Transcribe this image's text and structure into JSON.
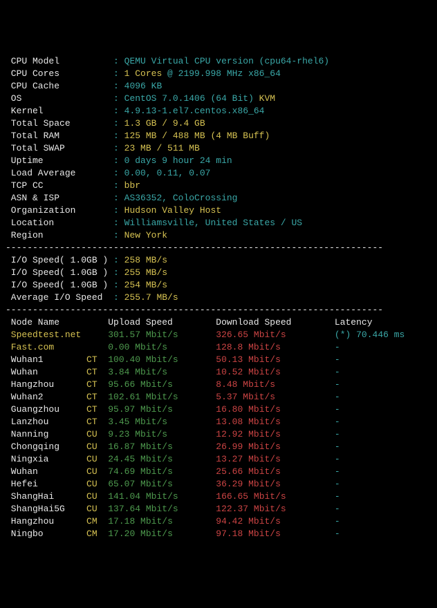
{
  "sysinfo": [
    {
      "label": "CPU Model",
      "value": "QEMU Virtual CPU version (cpu64-rhel6)",
      "color": "cyan"
    },
    {
      "label": "CPU Cores",
      "value": "1 Cores",
      "color": "yellow",
      "suffix": " @ 2199.998 MHz x86_64",
      "suffix_color": "cyan"
    },
    {
      "label": "CPU Cache",
      "value": "4096 KB",
      "color": "cyan"
    },
    {
      "label": "OS",
      "value": "CentOS 7.0.1406 (64 Bit)",
      "color": "cyan",
      "suffix": " KVM",
      "suffix_color": "yellow"
    },
    {
      "label": "Kernel",
      "value": "4.9.13-1.el7.centos.x86_64",
      "color": "cyan"
    },
    {
      "label": "Total Space",
      "value": "1.3 GB / 9.4 GB",
      "color": "yellow"
    },
    {
      "label": "Total RAM",
      "value": "125 MB / 488 MB (4 MB Buff)",
      "color": "yellow"
    },
    {
      "label": "Total SWAP",
      "value": "23 MB / 511 MB",
      "color": "yellow"
    },
    {
      "label": "Uptime",
      "value": "0 days 9 hour 24 min",
      "color": "cyan"
    },
    {
      "label": "Load Average",
      "value": "0.00, 0.11, 0.07",
      "color": "cyan"
    },
    {
      "label": "TCP CC",
      "value": "bbr",
      "color": "yellow"
    },
    {
      "label": "ASN & ISP",
      "value": "AS36352, ColoCrossing",
      "color": "cyan"
    },
    {
      "label": "Organization",
      "value": "Hudson Valley Host",
      "color": "yellow"
    },
    {
      "label": "Location",
      "value": "Williamsville, United States / US",
      "color": "cyan"
    },
    {
      "label": "Region",
      "value": "New York",
      "color": "yellow"
    }
  ],
  "io": [
    {
      "label": "I/O Speed( 1.0GB )",
      "value": "258 MB/s"
    },
    {
      "label": "I/O Speed( 1.0GB )",
      "value": "255 MB/s"
    },
    {
      "label": "I/O Speed( 1.0GB )",
      "value": "254 MB/s"
    },
    {
      "label": "Average I/O Speed",
      "value": "255.7 MB/s"
    }
  ],
  "speed_header": {
    "node": "Node Name",
    "upload": "Upload Speed",
    "download": "Download Speed",
    "latency": "Latency"
  },
  "speed": [
    {
      "node": "Speedtest.net",
      "isp": "",
      "upload": "301.57 Mbit/s",
      "download": "326.65 Mbit/s",
      "latency": "(*) 70.446 ms",
      "node_color": "yellow"
    },
    {
      "node": "Fast.com",
      "isp": "",
      "upload": "0.00 Mbit/s",
      "download": "128.8 Mbit/s",
      "latency": "-",
      "node_color": "yellow"
    },
    {
      "node": "Wuhan1",
      "isp": "CT",
      "upload": "100.40 Mbit/s",
      "download": "50.13 Mbit/s",
      "latency": "-",
      "node_color": "white"
    },
    {
      "node": "Wuhan",
      "isp": "CT",
      "upload": "3.84 Mbit/s",
      "download": "10.52 Mbit/s",
      "latency": "-",
      "node_color": "white"
    },
    {
      "node": "Hangzhou",
      "isp": "CT",
      "upload": "95.66 Mbit/s",
      "download": "8.48 Mbit/s",
      "latency": "-",
      "node_color": "white"
    },
    {
      "node": "Wuhan2",
      "isp": "CT",
      "upload": "102.61 Mbit/s",
      "download": "5.37 Mbit/s",
      "latency": "-",
      "node_color": "white"
    },
    {
      "node": "Guangzhou",
      "isp": "CT",
      "upload": "95.97 Mbit/s",
      "download": "16.80 Mbit/s",
      "latency": "-",
      "node_color": "white"
    },
    {
      "node": "Lanzhou",
      "isp": "CT",
      "upload": "3.45 Mbit/s",
      "download": "13.08 Mbit/s",
      "latency": "-",
      "node_color": "white"
    },
    {
      "node": "Nanning",
      "isp": "CU",
      "upload": "9.23 Mbit/s",
      "download": "12.92 Mbit/s",
      "latency": "-",
      "node_color": "white"
    },
    {
      "node": "Chongqing",
      "isp": "CU",
      "upload": "16.87 Mbit/s",
      "download": "26.99 Mbit/s",
      "latency": "-",
      "node_color": "white"
    },
    {
      "node": "Ningxia",
      "isp": "CU",
      "upload": "24.45 Mbit/s",
      "download": "13.27 Mbit/s",
      "latency": "-",
      "node_color": "white"
    },
    {
      "node": "Wuhan",
      "isp": "CU",
      "upload": "74.69 Mbit/s",
      "download": "25.66 Mbit/s",
      "latency": "-",
      "node_color": "white"
    },
    {
      "node": "Hefei",
      "isp": "CU",
      "upload": "65.07 Mbit/s",
      "download": "36.29 Mbit/s",
      "latency": "-",
      "node_color": "white"
    },
    {
      "node": "ShangHai",
      "isp": "CU",
      "upload": "141.04 Mbit/s",
      "download": "166.65 Mbit/s",
      "latency": "-",
      "node_color": "white"
    },
    {
      "node": "ShangHai5G",
      "isp": "CU",
      "upload": "137.64 Mbit/s",
      "download": "122.37 Mbit/s",
      "latency": "-",
      "node_color": "white"
    },
    {
      "node": "Hangzhou",
      "isp": "CM",
      "upload": "17.18 Mbit/s",
      "download": "94.42 Mbit/s",
      "latency": "-",
      "node_color": "white"
    },
    {
      "node": "Ningbo",
      "isp": "CM",
      "upload": "17.20 Mbit/s",
      "download": "97.18 Mbit/s",
      "latency": "-",
      "node_color": "white"
    }
  ],
  "divider": "----------------------------------------------------------------------"
}
